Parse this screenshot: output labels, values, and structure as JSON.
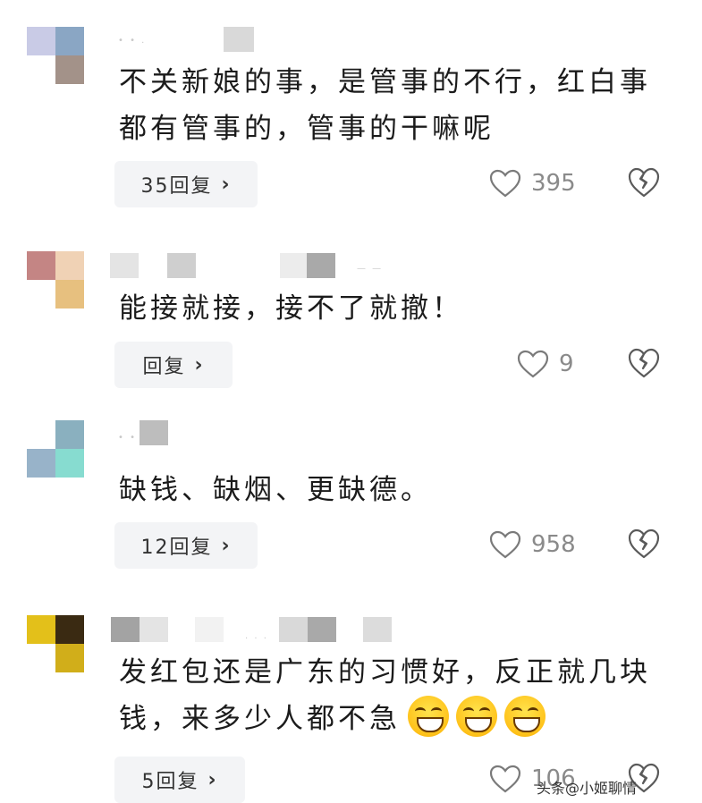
{
  "comments": [
    {
      "text": "不关新娘的事，是管事的不行，红白事都有管事的，管事的干嘛呢",
      "reply_label": "35回复",
      "likes": "395",
      "avatar_colors": [
        "#c9cbe6",
        "#8aa6c4",
        "#ffffff",
        "#a39289"
      ]
    },
    {
      "text": "能接就接，接不了就撤！",
      "reply_label": "回复",
      "likes": "9",
      "avatar_colors": [
        "#c48584",
        "#f0d2b5",
        "#ffffff",
        "#e7c07f"
      ]
    },
    {
      "text": "缺钱、缺烟、更缺德。",
      "reply_label": "12回复",
      "likes": "958",
      "avatar_colors": [
        "#ffffff",
        "#8ab0bf",
        "#98b3c9",
        "#87dcd0"
      ]
    },
    {
      "text": "发红包还是广东的习惯好，反正就几块钱，来多少人都不急",
      "reply_label": "5回复",
      "likes": "106",
      "avatar_colors": [
        "#e3c01a",
        "#3a2a12",
        "#ffffff",
        "#d1ae1a"
      ]
    }
  ],
  "icons": {
    "like": "heart-outline-icon",
    "dislike": "broken-heart-icon",
    "reply_chevron": "chevron-right-icon",
    "emoji": "grinning-squint-face-icon"
  },
  "watermark": "头条@小姬聊情"
}
